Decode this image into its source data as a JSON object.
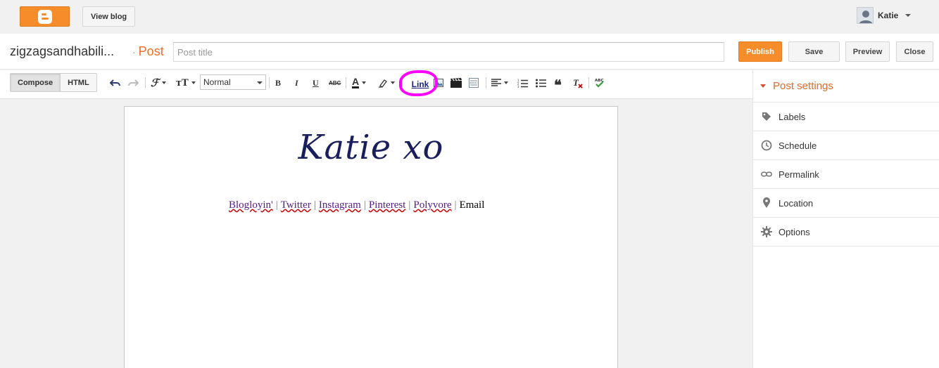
{
  "topbar": {
    "view_blog": "View blog",
    "username": "Katie"
  },
  "titlebar": {
    "blog_name": "zigzagsandhabili...",
    "crumb_dot": "·",
    "crumb_label": "Post",
    "post_title_placeholder": "Post title",
    "post_title_value": "",
    "publish": "Publish",
    "save": "Save",
    "preview": "Preview",
    "close": "Close"
  },
  "toolbar": {
    "compose": "Compose",
    "html": "HTML",
    "font_style": "Normal",
    "bold": "B",
    "italic": "I",
    "underline": "U",
    "strike": "ABC",
    "link": "Link",
    "spellcheck": "ABC"
  },
  "post": {
    "signature": "Katie xo",
    "links": [
      "Blogloyin'",
      "Twitter",
      "Instagram",
      "Pinterest",
      "Polyvore"
    ],
    "last_item": "Email",
    "separator": "|"
  },
  "sidebar": {
    "title": "Post settings",
    "items": [
      {
        "label": "Labels",
        "icon": "tag-icon"
      },
      {
        "label": "Schedule",
        "icon": "clock-icon"
      },
      {
        "label": "Permalink",
        "icon": "link-icon"
      },
      {
        "label": "Location",
        "icon": "pin-icon"
      },
      {
        "label": "Options",
        "icon": "gear-icon"
      }
    ]
  },
  "colors": {
    "brand_orange": "#f68c2a",
    "accent_red": "#dd4b39",
    "highlight_magenta": "#ff00ff",
    "signature_navy": "#1a1f5c"
  }
}
